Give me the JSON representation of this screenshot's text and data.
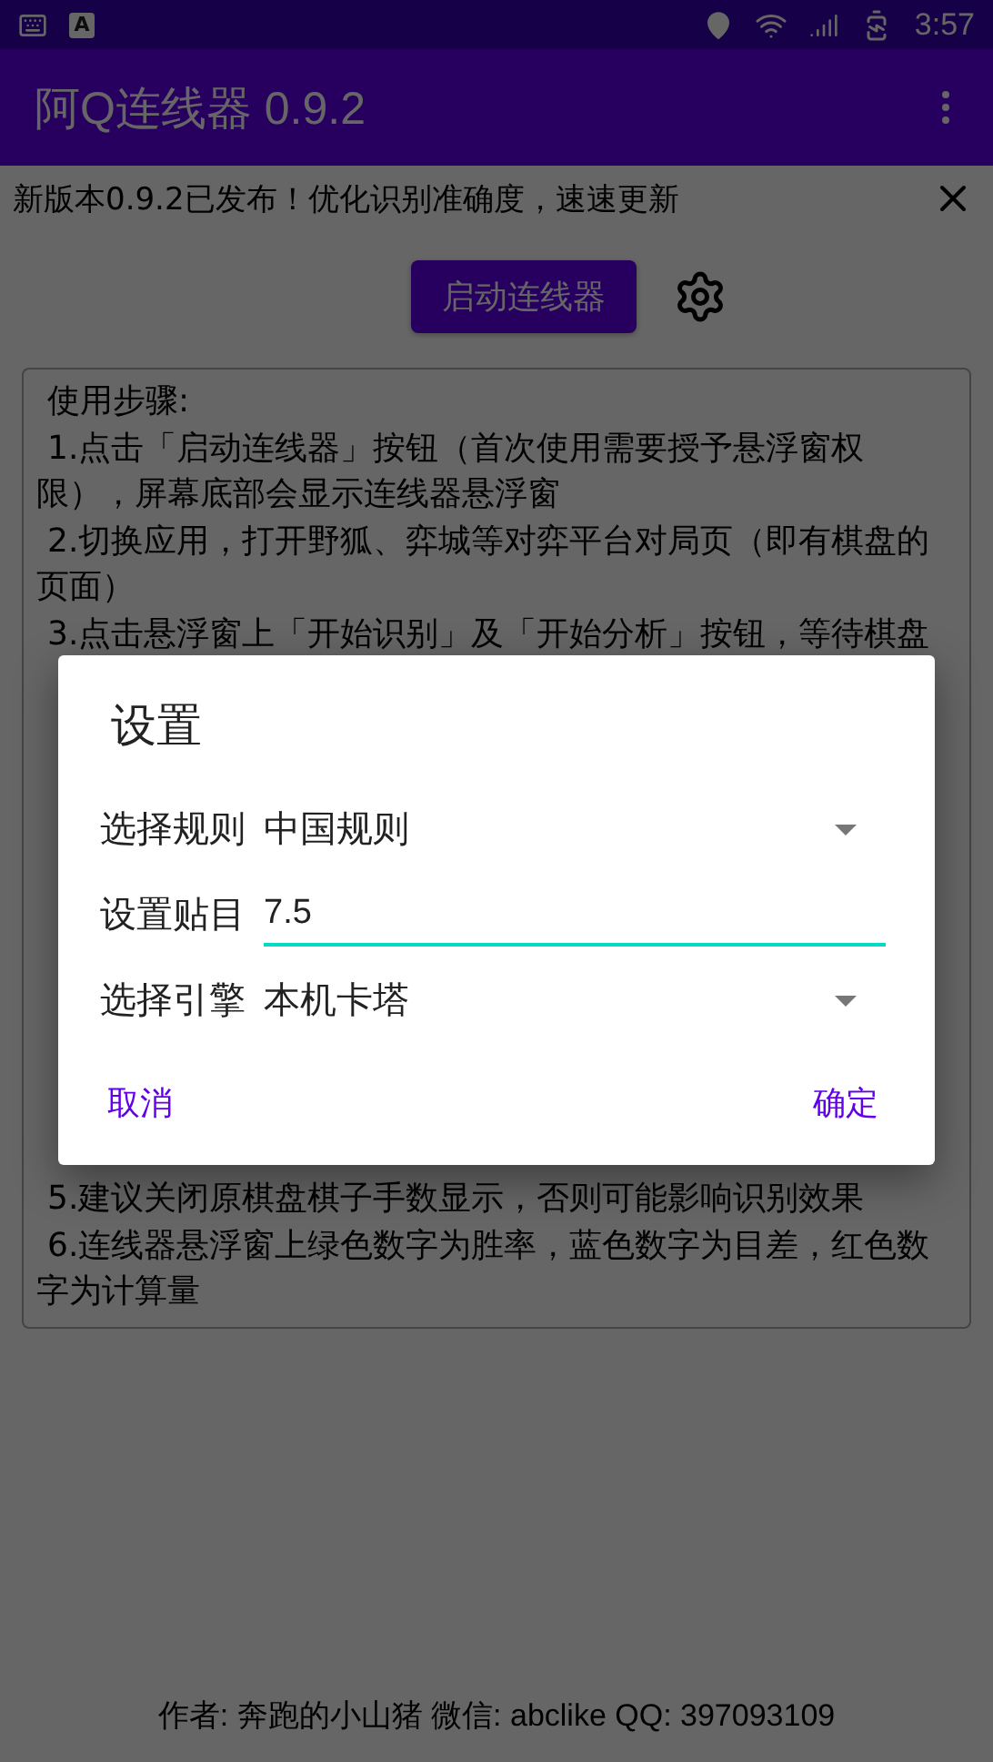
{
  "status_bar": {
    "notification_letter": "A",
    "time": "3:57"
  },
  "app_bar": {
    "title": "阿Q连线器 0.9.2"
  },
  "banner": {
    "text": "新版本0.9.2已发布！优化识别准确度，速速更新"
  },
  "start_button": "启动连线器",
  "instructions": [
    [
      {
        "text": "使用步骤:",
        "wrapped": false
      },
      {
        "text": "1.点击「启动连线器」按钮（首次使用需要授予悬浮窗权",
        "wrapped": false
      },
      {
        "text": "限），屏幕底部会显示连线器悬浮窗",
        "wrapped": true
      },
      {
        "text": "2.切换应用，打开野狐、弈城等对弈平台对局页（即有棋盘的",
        "wrapped": false
      },
      {
        "text": "页面）",
        "wrapped": true
      },
      {
        "text": "3.点击悬浮窗上「开始识别」及「开始分析」按钮，等待棋盘",
        "wrapped": false
      }
    ],
    [
      {
        "text": "5.建议关闭原棋盘棋子手数显示，否则可能影响识别效果",
        "wrapped": false
      },
      {
        "text": "6.连线器悬浮窗上绿色数字为胜率，蓝色数字为目差，红色数",
        "wrapped": false
      },
      {
        "text": "字为计算量",
        "wrapped": true
      }
    ]
  ],
  "footer": "作者: 奔跑的小山猪 微信: abclike QQ: 397093109",
  "dialog": {
    "title": "设置",
    "fields": [
      {
        "kind": "select",
        "label": "选择规则",
        "value": "中国规则"
      },
      {
        "kind": "input",
        "label": "设置贴目",
        "value": "7.5"
      },
      {
        "kind": "select",
        "label": "选择引擎",
        "value": "本机卡塔"
      }
    ],
    "buttons": [
      {
        "label": "取消"
      },
      {
        "label": "确定"
      }
    ]
  }
}
